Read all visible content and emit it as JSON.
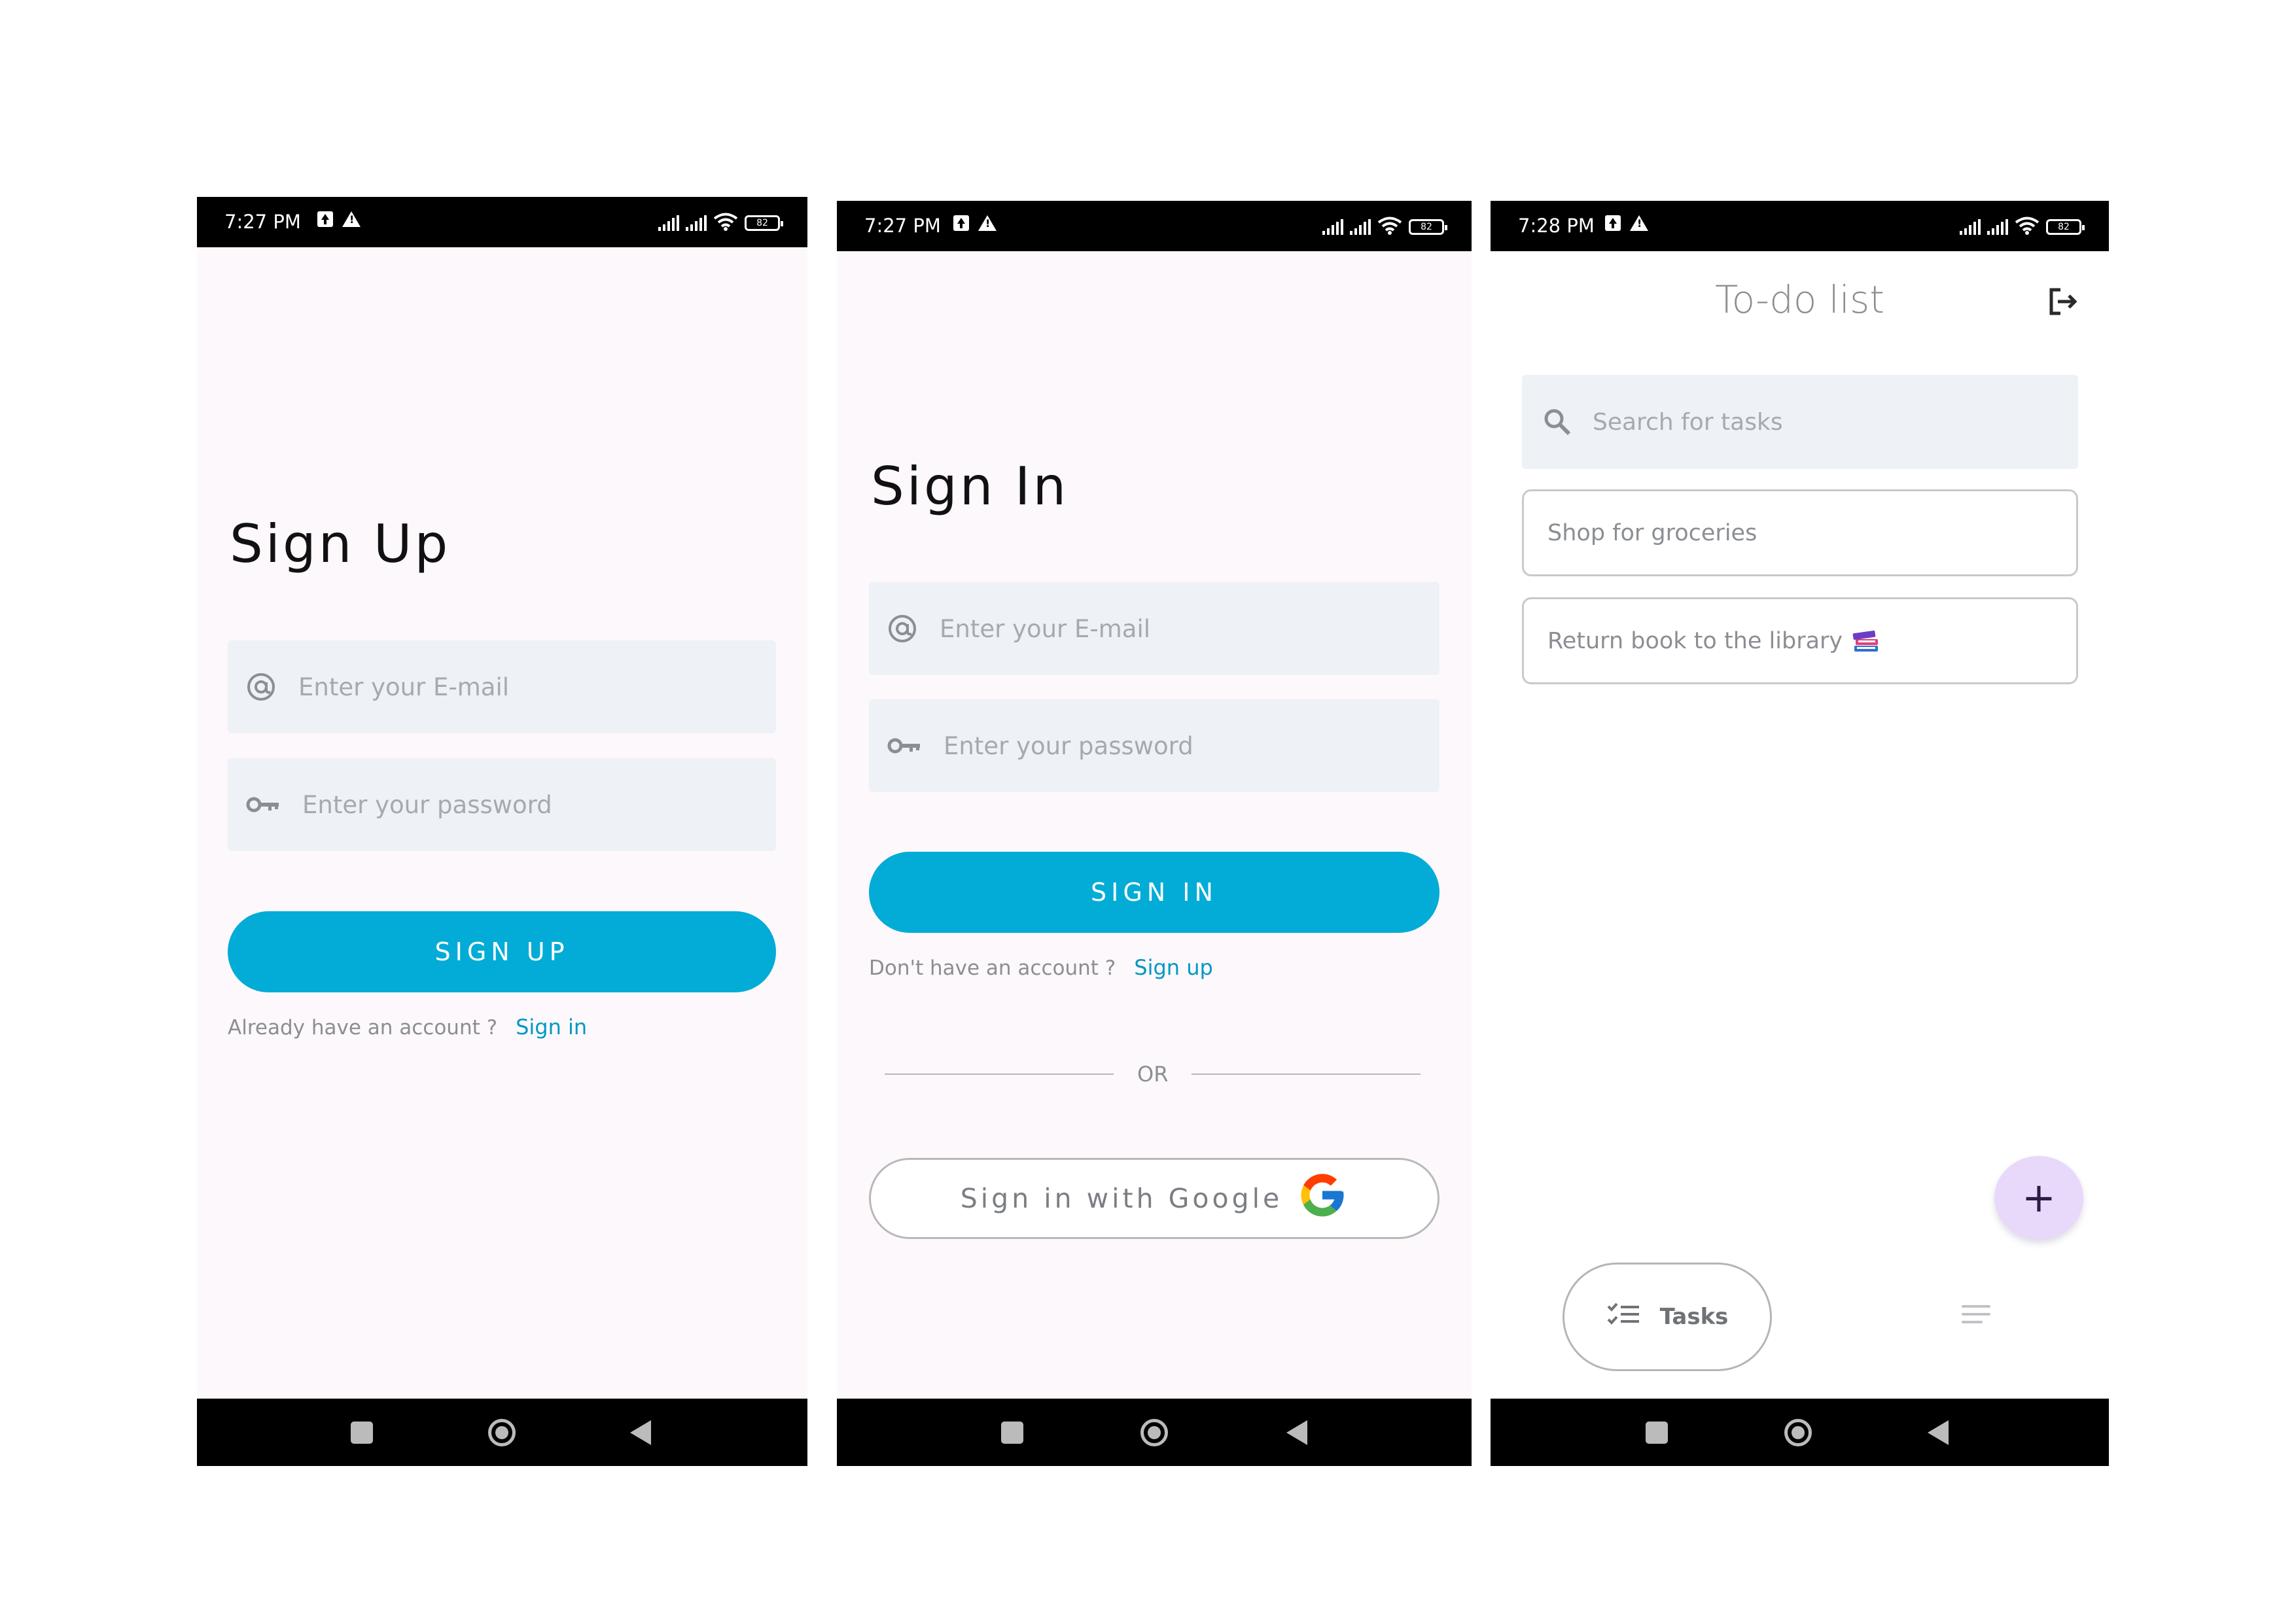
{
  "signup_screen": {
    "status_time": "7:27 PM",
    "battery": "82",
    "title": "Sign Up",
    "email_placeholder": "Enter your E-mail",
    "password_placeholder": "Enter your password",
    "button_label": "SIGN UP",
    "account_prompt": "Already have an account ?",
    "account_link": "Sign in"
  },
  "signin_screen": {
    "status_time": "7:27 PM",
    "battery": "82",
    "title": "Sign In",
    "email_placeholder": "Enter your E-mail",
    "password_placeholder": "Enter your password",
    "button_label": "SIGN IN",
    "account_prompt": "Don't have an account ?",
    "account_link": "Sign up",
    "divider_label": "OR",
    "google_button_label": "Sign in with Google"
  },
  "todo_screen": {
    "status_time": "7:28 PM",
    "battery": "82",
    "title": "To-do list",
    "search_placeholder": "Search for tasks",
    "tasks": [
      {
        "text": "Shop for groceries",
        "icon": ""
      },
      {
        "text": "Return book to the library",
        "icon": "books-icon"
      }
    ],
    "fab_label": "+",
    "tab_label": "Tasks"
  },
  "icons": {
    "email": "at-sign-icon",
    "password": "key-icon",
    "search": "search-icon",
    "logout": "logout-icon",
    "google": "google-logo-icon",
    "tasks_tab": "checklist-icon",
    "menu": "menu-icon"
  },
  "colors": {
    "primary": "#02acd6",
    "link": "#0098c4",
    "screen_bg": "#fdf8fb",
    "field_bg": "#eef1f5",
    "fab_bg": "#e8d9fb"
  }
}
